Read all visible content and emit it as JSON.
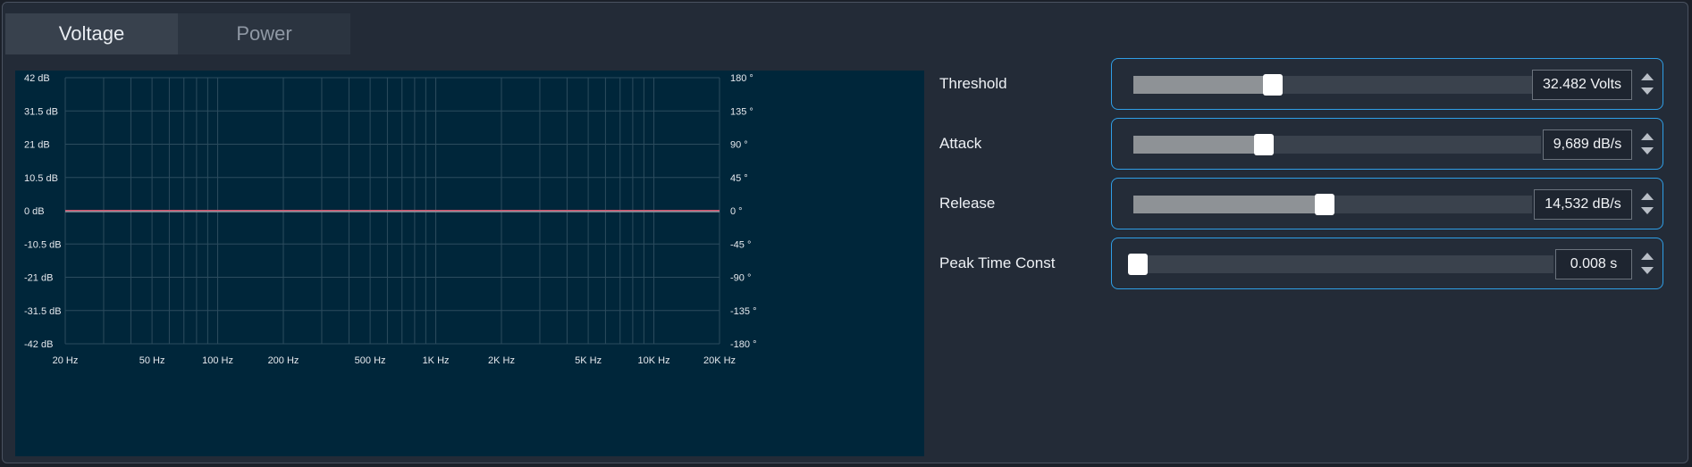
{
  "tabs": [
    {
      "label": "Voltage",
      "active": true
    },
    {
      "label": "Power",
      "active": false
    }
  ],
  "chart_data": {
    "type": "line",
    "x_scale": "log",
    "xlim": [
      20,
      20000
    ],
    "ylim_left": [
      -42,
      42
    ],
    "ylim_right": [
      -180,
      180
    ],
    "x_ticks": [
      {
        "value": 20,
        "label": "20 Hz"
      },
      {
        "value": 50,
        "label": "50 Hz"
      },
      {
        "value": 100,
        "label": "100 Hz"
      },
      {
        "value": 200,
        "label": "200 Hz"
      },
      {
        "value": 500,
        "label": "500 Hz"
      },
      {
        "value": 1000,
        "label": "1K Hz"
      },
      {
        "value": 2000,
        "label": "2K Hz"
      },
      {
        "value": 5000,
        "label": "5K Hz"
      },
      {
        "value": 10000,
        "label": "10K Hz"
      },
      {
        "value": 20000,
        "label": "20K Hz"
      }
    ],
    "y_left_ticks": [
      {
        "value": 42,
        "label": "42 dB"
      },
      {
        "value": 31.5,
        "label": "31.5 dB"
      },
      {
        "value": 21,
        "label": "21 dB"
      },
      {
        "value": 10.5,
        "label": "10.5 dB"
      },
      {
        "value": 0,
        "label": "0 dB"
      },
      {
        "value": -10.5,
        "label": "-10.5 dB"
      },
      {
        "value": -21,
        "label": "-21 dB"
      },
      {
        "value": -31.5,
        "label": "-31.5 dB"
      },
      {
        "value": -42,
        "label": "-42 dB"
      }
    ],
    "y_right_ticks": [
      {
        "value": 180,
        "label": "180 °"
      },
      {
        "value": 135,
        "label": "135 °"
      },
      {
        "value": 90,
        "label": "90 °"
      },
      {
        "value": 45,
        "label": "45 °"
      },
      {
        "value": 0,
        "label": "0 °"
      },
      {
        "value": -45,
        "label": "-45 °"
      },
      {
        "value": -90,
        "label": "-90 °"
      },
      {
        "value": -135,
        "label": "-135 °"
      },
      {
        "value": -180,
        "label": "-180 °"
      }
    ],
    "series": [
      {
        "color": "#d4506a",
        "x": [
          20,
          20000
        ],
        "y": [
          0,
          0
        ]
      },
      {
        "color": "#8c96a0",
        "x": [
          20,
          20000
        ],
        "y": [
          0,
          0
        ]
      }
    ],
    "grid": true
  },
  "controls": [
    {
      "label": "Threshold",
      "value": "32.482 Volts",
      "level": 0.32
    },
    {
      "label": "Attack",
      "value": "9,689 dB/s",
      "level": 0.32
    },
    {
      "label": "Release",
      "value": "14,532 dB/s",
      "level": 0.48
    },
    {
      "label": "Peak Time Const",
      "value": "0.008 s",
      "level": 0.01
    }
  ],
  "colors": {
    "accent": "#2f9ee6",
    "plot_bg": "#00263a",
    "panel_bg": "#232b37"
  },
  "icons": {
    "spin_up": "caret-up-icon",
    "spin_down": "caret-down-icon"
  }
}
